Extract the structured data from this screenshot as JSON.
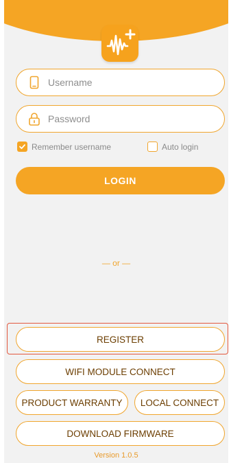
{
  "login": {
    "username_placeholder": "Username",
    "password_placeholder": "Password",
    "remember_label": "Remember username",
    "remember_checked": true,
    "auto_login_label": "Auto login",
    "auto_login_checked": false,
    "login_button": "LOGIN",
    "or_separator": "— or —"
  },
  "actions": {
    "register": "REGISTER",
    "wifi_module_connect": "WIFI MODULE CONNECT",
    "product_warranty": "PRODUCT WARRANTY",
    "local_connect": "LOCAL CONNECT",
    "download_firmware": "DOWNLOAD FIRMWARE"
  },
  "footer": {
    "version": "Version 1.0.5"
  },
  "icons": {
    "logo": "app-logo-waveform-plus",
    "username": "phone-icon",
    "password": "lock-icon",
    "checkbox": "check-icon"
  },
  "colors": {
    "accent": "#f5a524",
    "border": "#f0a52c",
    "button_text": "#6b3d00",
    "highlight": "#e2583e"
  }
}
